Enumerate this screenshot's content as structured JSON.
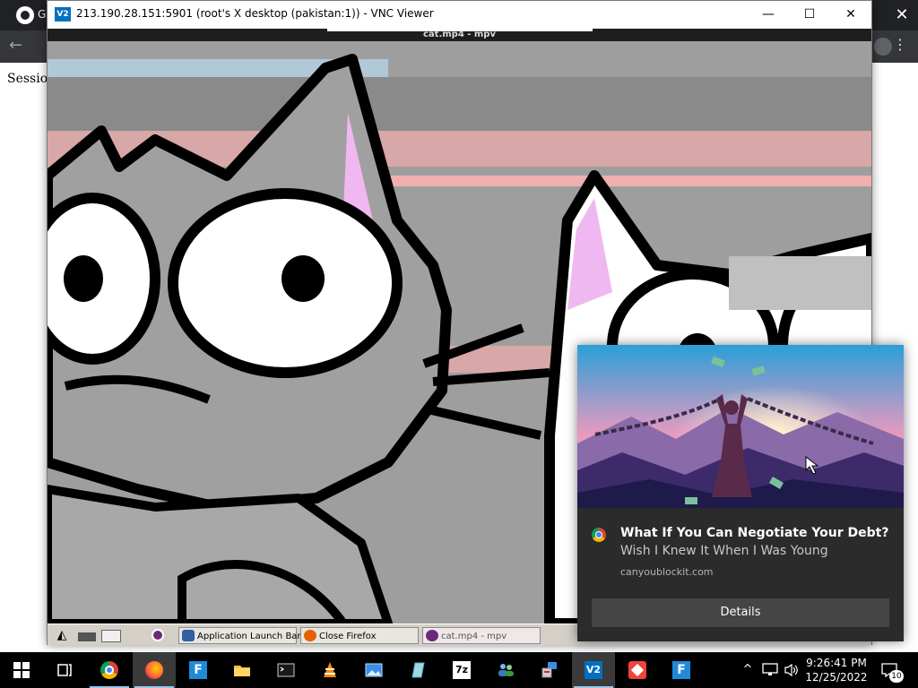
{
  "browser": {
    "tab_initial": "G",
    "close_glyph": "✕",
    "back_glyph": "←",
    "menu_glyph": "⋮",
    "page_text": "Session"
  },
  "vnc": {
    "app_icon_text": "V2",
    "title": "213.190.28.151:5901 (root's X desktop (pakistan:1)) - VNC Viewer",
    "minimize_glyph": "—",
    "maximize_glyph": "☐",
    "close_glyph": "✕"
  },
  "mpv": {
    "title": "cat.mp4 - mpv"
  },
  "lx_panel": {
    "launch_bar": "Application Launch Bar",
    "close_firefox": "Close Firefox",
    "mpv_task": "cat.mp4 - mpv"
  },
  "notification": {
    "title": "What If You Can Negotiate Your Debt?",
    "subtitle": "Wish I Knew It When I Was Young",
    "source": "canyoublockit.com",
    "button": "Details"
  },
  "taskbar": {
    "apps": [
      {
        "name": "start",
        "icon": "windows-icon"
      },
      {
        "name": "task-view",
        "icon": "task-view-icon"
      },
      {
        "name": "chrome",
        "icon": "chrome-icon"
      },
      {
        "name": "firefox",
        "icon": "firefox-icon"
      },
      {
        "name": "app-f",
        "icon": "f-icon",
        "label": "F"
      },
      {
        "name": "explorer",
        "icon": "folder-icon"
      },
      {
        "name": "terminal",
        "icon": "terminal-icon"
      },
      {
        "name": "vlc",
        "icon": "vlc-icon"
      },
      {
        "name": "photos",
        "icon": "image-icon"
      },
      {
        "name": "notes",
        "icon": "note-icon"
      },
      {
        "name": "7zip",
        "icon": "7zip-icon",
        "label": "7z"
      },
      {
        "name": "users",
        "icon": "users-icon"
      },
      {
        "name": "network-tool",
        "icon": "network-tool-icon"
      },
      {
        "name": "vnc-viewer",
        "icon": "vnc-icon",
        "label": "V2"
      },
      {
        "name": "anydesk",
        "icon": "anydesk-icon"
      },
      {
        "name": "app-f2",
        "icon": "f-icon",
        "label": "F"
      }
    ],
    "tray_chevron": "^",
    "time": "9:26:41 PM",
    "date": "12/25/2022",
    "notification_count": "10"
  },
  "colors": {
    "taskbar_bg": "#000000",
    "accent": "#0078d7",
    "toast_bg": "#2b2b2b"
  }
}
